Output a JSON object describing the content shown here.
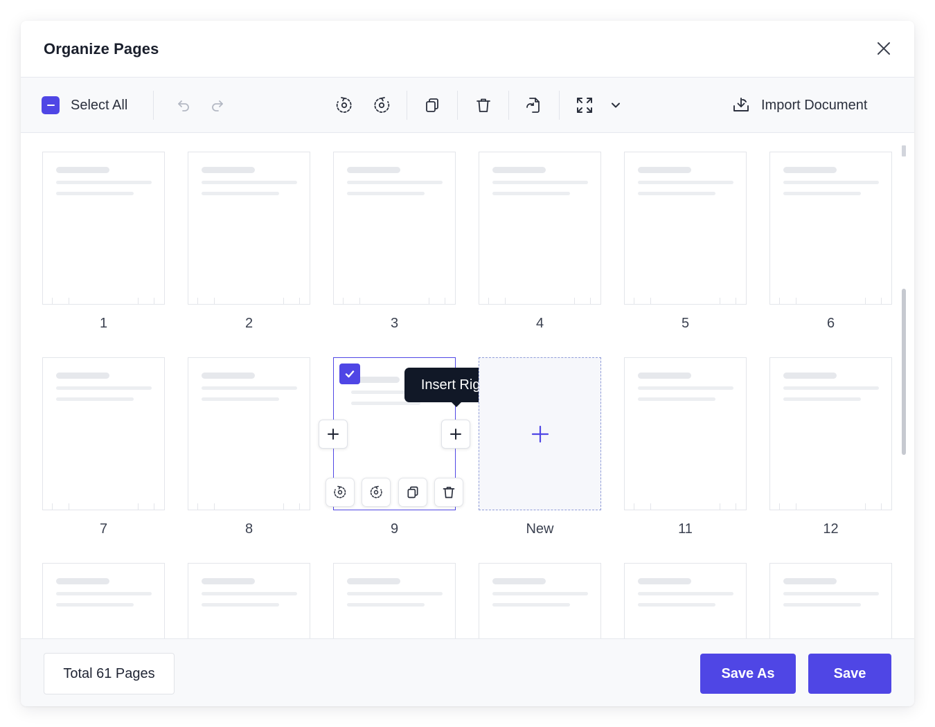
{
  "dialog": {
    "title": "Organize Pages"
  },
  "toolbar": {
    "select_all_label": "Select All",
    "import_label": "Import Document"
  },
  "pages": {
    "row1": [
      "1",
      "2",
      "3",
      "4",
      "5",
      "6"
    ],
    "row2": [
      "7",
      "8",
      "9",
      "New",
      "11",
      "12"
    ]
  },
  "tooltip": {
    "text": "Insert Right"
  },
  "footer": {
    "total_label": "Total 61 Pages",
    "save_as_label": "Save As",
    "save_label": "Save"
  },
  "colors": {
    "accent": "#4f46e5",
    "tooltip_bg": "#111827"
  }
}
